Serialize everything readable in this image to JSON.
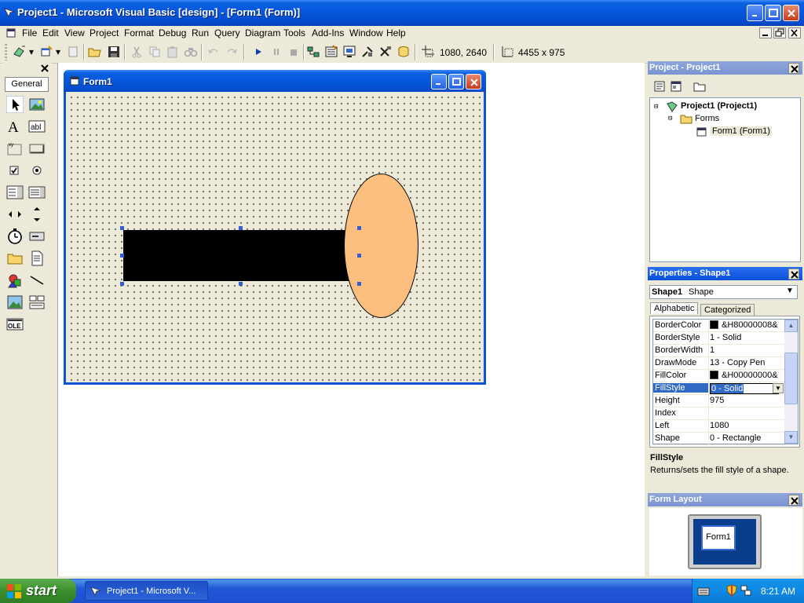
{
  "window": {
    "title": "Project1 - Microsoft Visual Basic [design] - [Form1 (Form)]"
  },
  "menu": [
    "File",
    "Edit",
    "View",
    "Project",
    "Format",
    "Debug",
    "Run",
    "Query",
    "Diagram",
    "Tools",
    "Add-Ins",
    "Window",
    "Help"
  ],
  "toolbar": {
    "position": "1080, 2640",
    "size": "4455 x 975"
  },
  "toolbox": {
    "tab": "General"
  },
  "form": {
    "title": "Form1"
  },
  "shapes": {
    "rect_fill": "#000000",
    "ellipse_fill": "#fdbf80",
    "ellipse_border": "#000000"
  },
  "project_panel": {
    "title": "Project - Project1",
    "tree": [
      "Project1 (Project1)",
      "Forms",
      "Form1 (Form1)"
    ]
  },
  "properties_panel": {
    "title": "Properties - Shape1",
    "object_name": "Shape1",
    "object_type": "Shape",
    "tabs": [
      "Alphabetic",
      "Categorized"
    ],
    "rows": [
      {
        "name": "BorderColor",
        "value": "&H80000008&",
        "swatch": true
      },
      {
        "name": "BorderStyle",
        "value": "1 - Solid"
      },
      {
        "name": "BorderWidth",
        "value": "1"
      },
      {
        "name": "DrawMode",
        "value": "13 - Copy Pen"
      },
      {
        "name": "FillColor",
        "value": "&H00000000&",
        "swatch": true
      },
      {
        "name": "FillStyle",
        "value": "0 - Solid",
        "selected": true
      },
      {
        "name": "Height",
        "value": "975"
      },
      {
        "name": "Index",
        "value": ""
      },
      {
        "name": "Left",
        "value": "1080"
      },
      {
        "name": "Shape",
        "value": "0 - Rectangle"
      }
    ],
    "desc_title": "FillStyle",
    "desc_text": "Returns/sets the fill style of a shape."
  },
  "layout_panel": {
    "title": "Form Layout",
    "form_label": "Form1"
  },
  "taskbar": {
    "start": "start",
    "item": "Project1 - Microsoft V...",
    "clock": "8:21 AM"
  }
}
